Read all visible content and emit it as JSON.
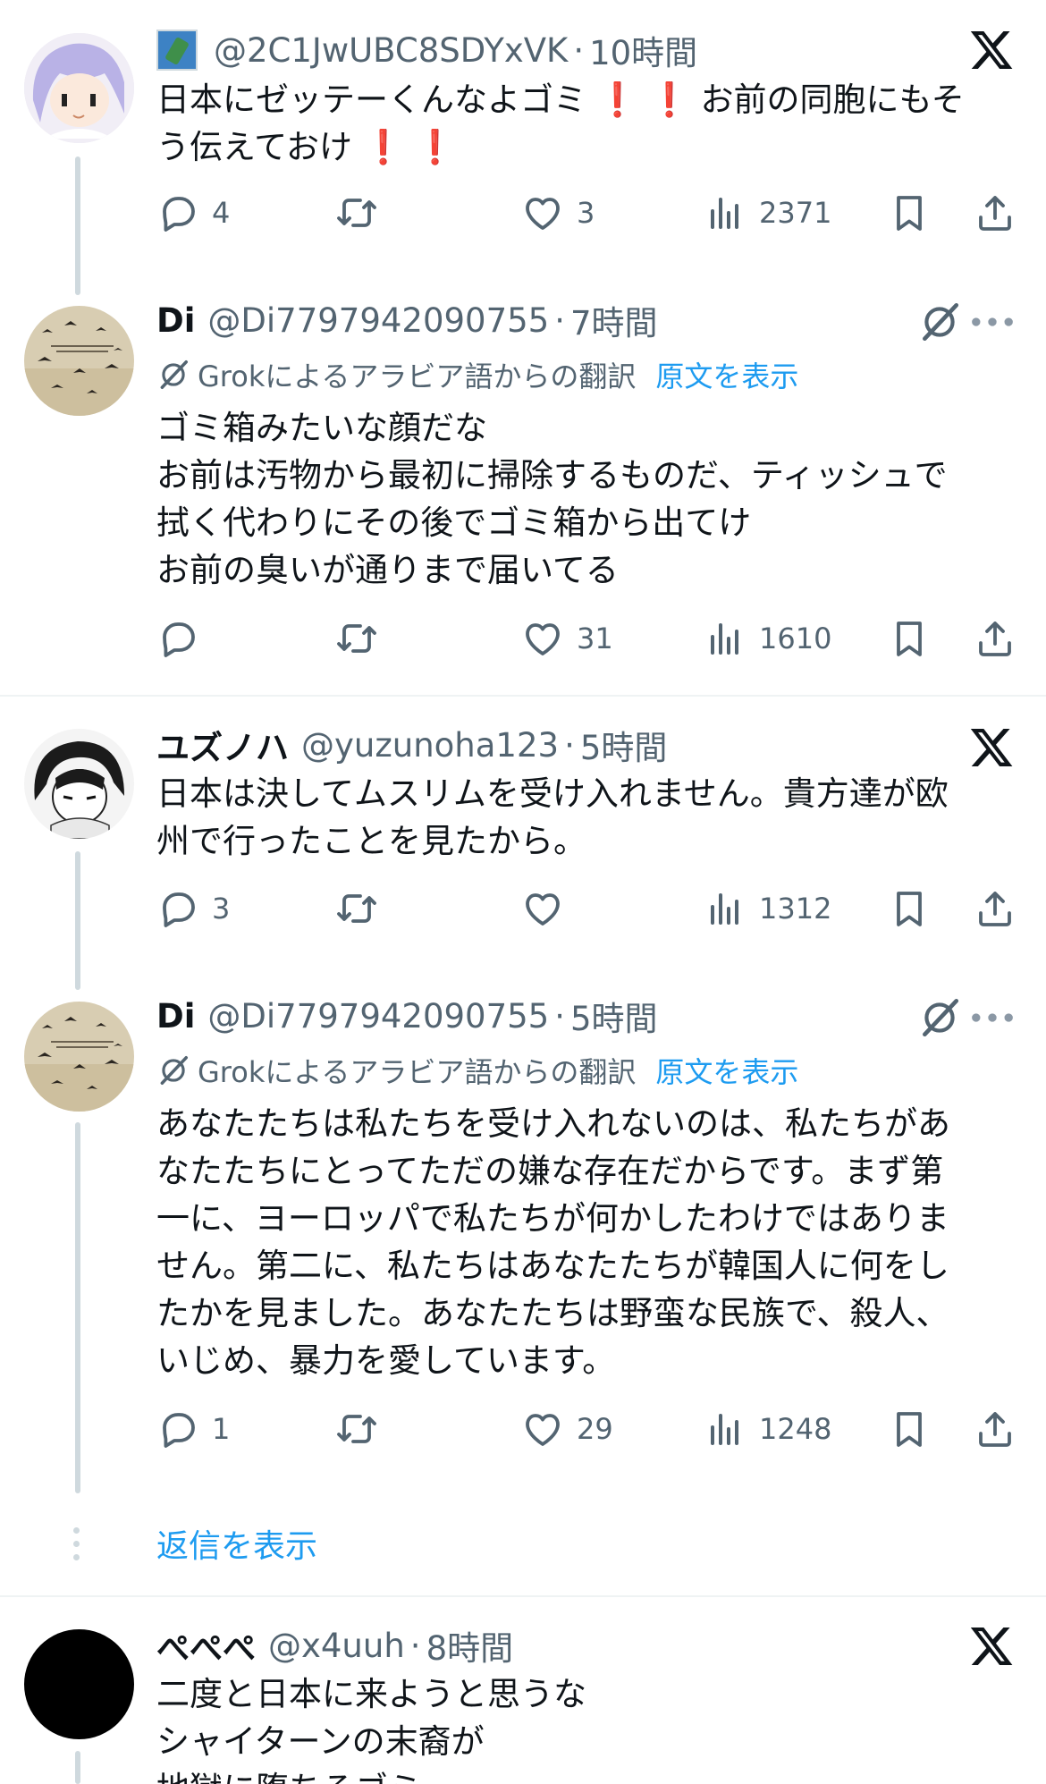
{
  "tweets": [
    {
      "handle": "@2C1JwUBC8SDYxVK",
      "separator": "·",
      "time": "10時間",
      "lines": [
        "日本にゼッテーくんなよゴミ",
        "お前の同胞にもそ",
        "う伝えておけ"
      ],
      "replies": "4",
      "likes": "3",
      "views": "2371"
    },
    {
      "name": "Di",
      "handle": "@Di7797942090755",
      "separator": "·",
      "time": "7時間",
      "translation_label": "Grokによるアラビア語からの翻訳",
      "show_original": "原文を表示",
      "lines": [
        "ゴミ箱みたいな顔だな",
        "お前は汚物から最初に掃除するものだ、ティッシュで",
        "拭く代わりにその後でゴミ箱から出てけ",
        "お前の臭いが通りまで届いてる"
      ],
      "likes": "31",
      "views": "1610"
    },
    {
      "name": "ユズノハ",
      "handle": "@yuzunoha123",
      "separator": "·",
      "time": "5時間",
      "lines": [
        "日本は決してムスリムを受け入れません。貴方達が欧",
        "州で行ったことを見たから。"
      ],
      "replies": "3",
      "views": "1312"
    },
    {
      "name": "Di",
      "handle": "@Di7797942090755",
      "separator": "·",
      "time": "5時間",
      "translation_label": "Grokによるアラビア語からの翻訳",
      "show_original": "原文を表示",
      "lines": [
        "あなたたちは私たちを受け入れないのは、私たちがあ",
        "なたたちにとってただの嫌な存在だからです。まず第",
        "一に、ヨーロッパで私たちが何かしたわけではありま",
        "せん。第二に、私たちはあなたたちが韓国人に何をし",
        "たかを見ました。あなたたちは野蛮な民族で、殺人、",
        "いじめ、暴力を愛しています。"
      ],
      "replies": "1",
      "likes": "29",
      "views": "1248"
    },
    {
      "name": "ぺぺぺ",
      "handle": "@x4uuh",
      "separator": "·",
      "time": "8時間",
      "lines": [
        "二度と日本に来ようと思うな",
        "シャイターンの末裔が",
        "地獄に堕ちろゴミ"
      ]
    }
  ],
  "show_replies": "返信を表示",
  "exclamation": "❗",
  "icons": {
    "reply": "reply-icon",
    "retweet": "retweet-icon",
    "like": "like-icon",
    "views": "views-icon",
    "bookmark": "bookmark-icon",
    "share": "share-icon",
    "x_logo": "x-logo-icon",
    "grok": "grok-icon",
    "more": "more-icon",
    "flag": "japan-map-flag-icon"
  },
  "colors": {
    "link": "#1d9bf0",
    "secondary_text": "#536471",
    "thread_line": "#cfd9de",
    "exclamation": "#e0202e"
  }
}
